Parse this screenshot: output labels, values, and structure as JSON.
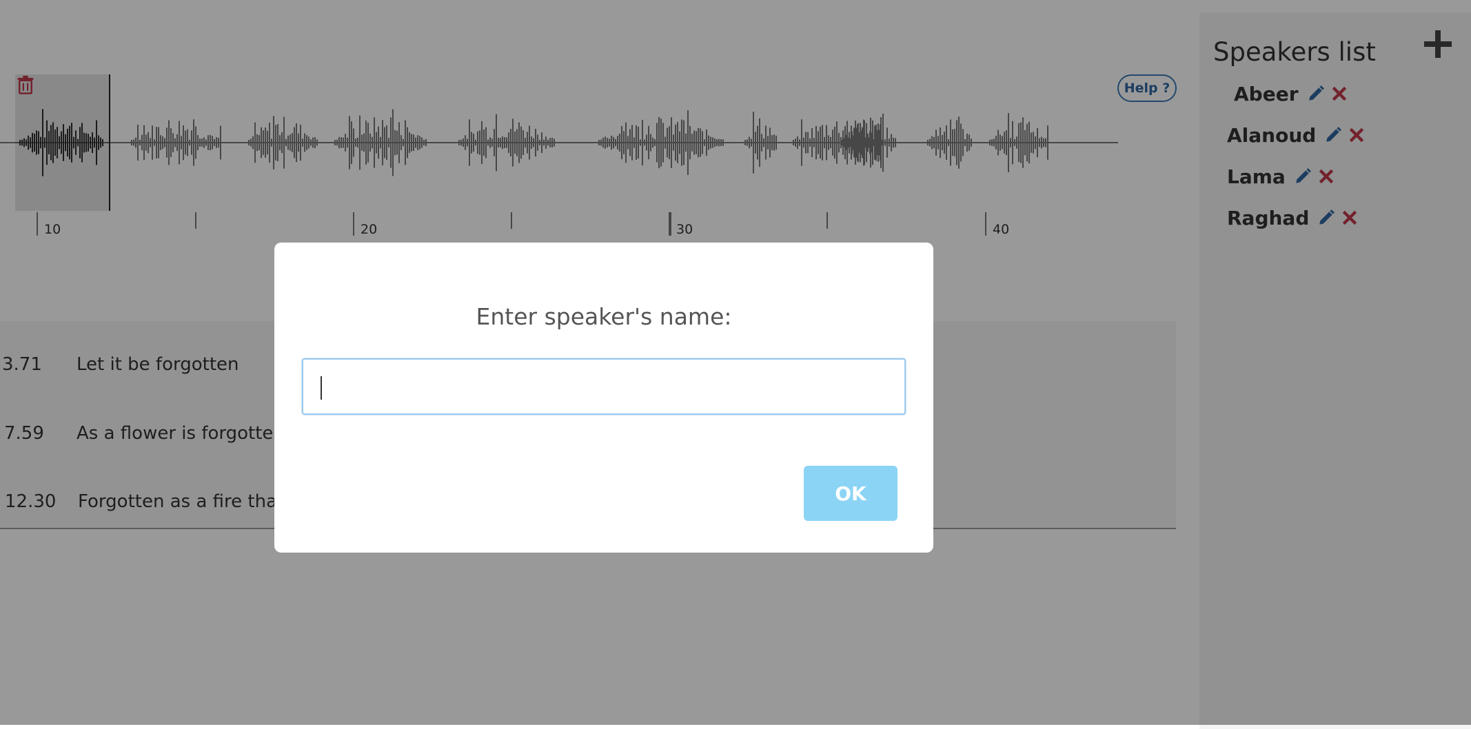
{
  "help": {
    "label": "Help ?"
  },
  "timeline": {
    "ticks": [
      {
        "label": "10"
      },
      {
        "label": ""
      },
      {
        "label": "20"
      },
      {
        "label": ""
      },
      {
        "label": "30"
      },
      {
        "label": ""
      },
      {
        "label": "40"
      }
    ]
  },
  "transcript": {
    "segments": [
      {
        "time": "3.71",
        "text": "Let it be forgotten"
      },
      {
        "time": "7.59",
        "text": "As a flower is forgotten"
      },
      {
        "time": "12.30",
        "text": "Forgotten as a fire that"
      }
    ]
  },
  "sidebar": {
    "title": "Speakers list",
    "speakers": [
      {
        "name": "Abeer"
      },
      {
        "name": "Alanoud"
      },
      {
        "name": "Lama"
      },
      {
        "name": "Raghad"
      }
    ]
  },
  "modal": {
    "title": "Enter speaker's name:",
    "input_value": "",
    "ok_label": "OK"
  },
  "colors": {
    "help_border": "#3a78b5",
    "edit_icon": "#2f66a0",
    "delete_icon": "#c0394b",
    "ok_button": "#8cd4f5",
    "input_border": "#9ccbf0"
  }
}
